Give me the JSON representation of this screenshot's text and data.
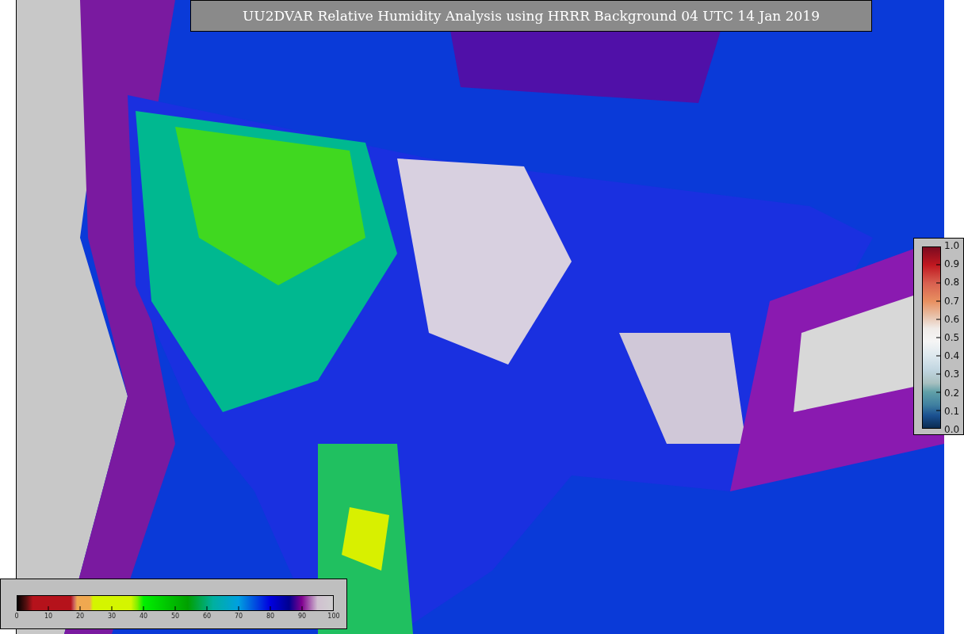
{
  "title": "UU2DVAR Relative Humidity Analysis using HRRR Background 04 UTC 14 Jan 2019",
  "humidity_colorbar": {
    "labels": [
      "0",
      "10",
      "20",
      "30",
      "40",
      "50",
      "60",
      "70",
      "80",
      "90",
      "100"
    ]
  },
  "weight_colorbar": {
    "labels": [
      "1.0",
      "0.9",
      "0.8",
      "0.7",
      "0.6",
      "0.5",
      "0.4",
      "0.3",
      "0.2",
      "0.1",
      "0.0"
    ]
  }
}
